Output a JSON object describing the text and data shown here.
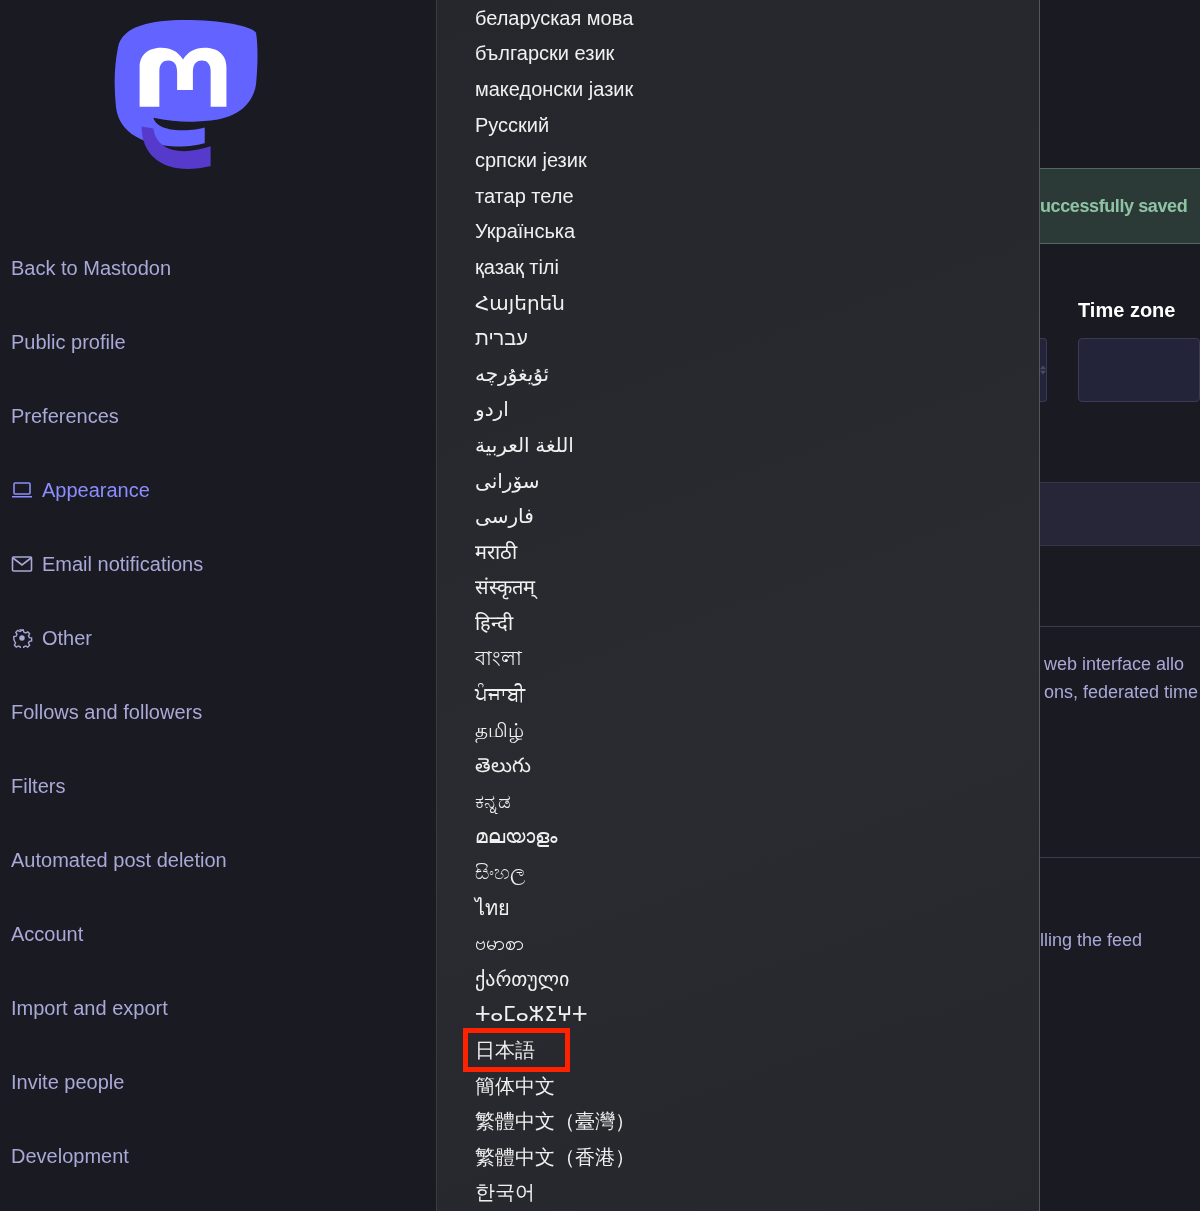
{
  "sidebar": {
    "items": [
      {
        "label": "Back to Mastodon",
        "kind": "plain",
        "selected": false
      },
      {
        "label": "Public profile",
        "kind": "plain",
        "selected": false
      },
      {
        "label": "Preferences",
        "kind": "plain",
        "selected": false
      },
      {
        "label": "Appearance",
        "kind": "laptop",
        "selected": true
      },
      {
        "label": "Email notifications",
        "kind": "mail",
        "selected": false
      },
      {
        "label": "Other",
        "kind": "gear",
        "selected": false
      },
      {
        "label": "Follows and followers",
        "kind": "plain",
        "selected": false
      },
      {
        "label": "Filters",
        "kind": "plain",
        "selected": false
      },
      {
        "label": "Automated post deletion",
        "kind": "plain",
        "selected": false
      },
      {
        "label": "Account",
        "kind": "plain",
        "selected": false
      },
      {
        "label": "Import and export",
        "kind": "plain",
        "selected": false
      },
      {
        "label": "Invite people",
        "kind": "plain",
        "selected": false
      },
      {
        "label": "Development",
        "kind": "plain",
        "selected": false
      }
    ]
  },
  "language_menu": {
    "options": [
      {
        "label": "беларуская мова",
        "selected": false
      },
      {
        "label": "български език",
        "selected": false
      },
      {
        "label": "македонски јазик",
        "selected": false
      },
      {
        "label": "Русский",
        "selected": false
      },
      {
        "label": "српски језик",
        "selected": false
      },
      {
        "label": "татар теле",
        "selected": false
      },
      {
        "label": "Українська",
        "selected": false
      },
      {
        "label": "қазақ тілі",
        "selected": false
      },
      {
        "label": "Հայերեն",
        "selected": false
      },
      {
        "label": "עברית",
        "selected": false
      },
      {
        "label": "ئۇيغۇرچە",
        "selected": false
      },
      {
        "label": "اردو",
        "selected": false
      },
      {
        "label": "اللغة العربية",
        "selected": false
      },
      {
        "label": "سۆرانی",
        "selected": false
      },
      {
        "label": "فارسی",
        "selected": false
      },
      {
        "label": "मराठी",
        "selected": false
      },
      {
        "label": "संस्कृतम्",
        "selected": false
      },
      {
        "label": "हिन्दी",
        "selected": false
      },
      {
        "label": "বাংলা",
        "selected": false
      },
      {
        "label": "ਪੰਜਾਬੀ",
        "selected": false
      },
      {
        "label": "தமிழ்",
        "selected": false
      },
      {
        "label": "తెలుగు",
        "selected": false
      },
      {
        "label": "ಕನ್ನಡ",
        "selected": false
      },
      {
        "label": "മലയാളം",
        "selected": false
      },
      {
        "label": "සිංහල",
        "selected": false
      },
      {
        "label": "ไทย",
        "selected": false
      },
      {
        "label": "ဗမာစာ",
        "selected": false
      },
      {
        "label": "ქართული",
        "selected": false
      },
      {
        "label": "ⵜⴰⵎⴰⵣⵉⵖⵜ",
        "selected": false
      },
      {
        "label": "日本語",
        "selected": true
      },
      {
        "label": "簡体中文",
        "selected": false
      },
      {
        "label": "繁體中文（臺灣）",
        "selected": false
      },
      {
        "label": "繁體中文（香港）",
        "selected": false
      },
      {
        "label": "한국어",
        "selected": false
      }
    ]
  },
  "notice": {
    "text": "uccessfully saved"
  },
  "time_zone": {
    "label": "Time zone"
  },
  "description": {
    "lines": [
      "web interface allo",
      "ons, federated time"
    ]
  },
  "hint": {
    "text": "lling the feed"
  }
}
